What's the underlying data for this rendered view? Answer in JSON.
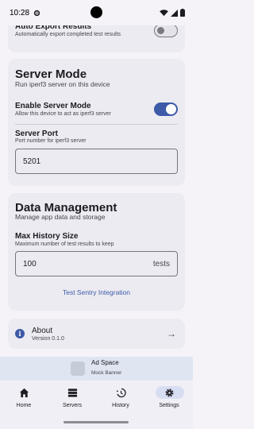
{
  "status_bar": {
    "time": "10:28"
  },
  "auto_export": {
    "title": "Auto Export Results",
    "subtitle": "Automatically export completed test results",
    "enabled": false
  },
  "server_mode": {
    "heading": "Server Mode",
    "subheading": "Run iperf3 server on this device",
    "enable_title": "Enable Server Mode",
    "enable_subtitle": "Allow this device to act as iperf3 server",
    "enabled": true,
    "port_title": "Server Port",
    "port_subtitle": "Port number for iperf3 server",
    "port_value": "5201"
  },
  "data_management": {
    "heading": "Data Management",
    "subheading": "Manage app data and storage",
    "history_title": "Max History Size",
    "history_subtitle": "Maximum number of test results to keep",
    "history_value": "100",
    "history_suffix": "tests",
    "sentry_link": "Test Sentry Integration"
  },
  "about": {
    "title": "About",
    "version": "Version 0.1.0",
    "arrow": "→"
  },
  "ad": {
    "title": "Ad Space",
    "subtitle": "Mock Banner"
  },
  "nav": {
    "items": [
      {
        "label": "Home",
        "icon": "home-icon",
        "active": false
      },
      {
        "label": "Servers",
        "icon": "servers-icon",
        "active": false
      },
      {
        "label": "History",
        "icon": "history-icon",
        "active": false
      },
      {
        "label": "Settings",
        "icon": "gear-icon",
        "active": true
      }
    ]
  },
  "colors": {
    "accent": "#3d5aa8",
    "card": "#ecebf1",
    "background": "#f5f3f8"
  }
}
